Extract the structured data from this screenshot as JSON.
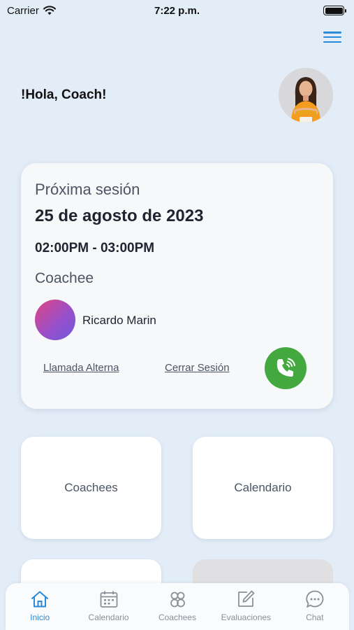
{
  "status_bar": {
    "carrier": "Carrier",
    "time": "7:22 p.m."
  },
  "header": {
    "greeting": "!Hola, Coach!"
  },
  "next_session": {
    "label": "Próxima sesión",
    "date": "25 de agosto de 2023",
    "time_range": "02:00PM - 03:00PM",
    "coachee_label": "Coachee",
    "coachee_name": "Ricardo Marin",
    "alt_call_link": "Llamada Alterna",
    "close_session_link": "Cerrar Sesión"
  },
  "tiles": [
    {
      "label": "Coachees"
    },
    {
      "label": "Calendario"
    },
    {
      "label": ""
    },
    {
      "label": ""
    }
  ],
  "tabbar": [
    {
      "label": "Inicio",
      "icon": "home-icon",
      "active": true
    },
    {
      "label": "Calendario",
      "icon": "calendar-icon",
      "active": false
    },
    {
      "label": "Coachees",
      "icon": "people-icon",
      "active": false
    },
    {
      "label": "Evaluaciones",
      "icon": "edit-icon",
      "active": false
    },
    {
      "label": "Chat",
      "icon": "chat-icon",
      "active": false
    }
  ],
  "colors": {
    "background": "#e3edf8",
    "accent": "#2a8ad8",
    "call_green": "#43a93f"
  }
}
